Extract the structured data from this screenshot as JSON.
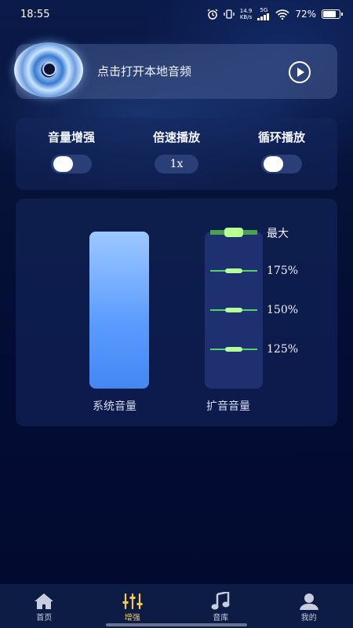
{
  "status_bar": {
    "time": "18:55",
    "net_speed_value": "14.9",
    "net_speed_unit": "KB/s",
    "network": "5G",
    "battery": "72%"
  },
  "player": {
    "title": "点击打开本地音频",
    "play_icon": "play-circle-icon"
  },
  "controls": {
    "volume_boost_label": "音量增强",
    "speed_label": "倍速播放",
    "speed_value": "1x",
    "loop_label": "循环播放",
    "volume_boost_on": false,
    "loop_on": false
  },
  "volume": {
    "system_label": "系统音量",
    "amp_label": "扩音音量",
    "levels": [
      "最大",
      "175%",
      "150%",
      "125%"
    ]
  },
  "bottom_nav": {
    "items": [
      {
        "label": "首页",
        "icon": "home-icon"
      },
      {
        "label": "增强",
        "icon": "equalizer-icon"
      },
      {
        "label": "音库",
        "icon": "music-note-icon"
      },
      {
        "label": "我的",
        "icon": "user-icon"
      }
    ],
    "active_index": 1,
    "active_color": "#f6c84c"
  }
}
